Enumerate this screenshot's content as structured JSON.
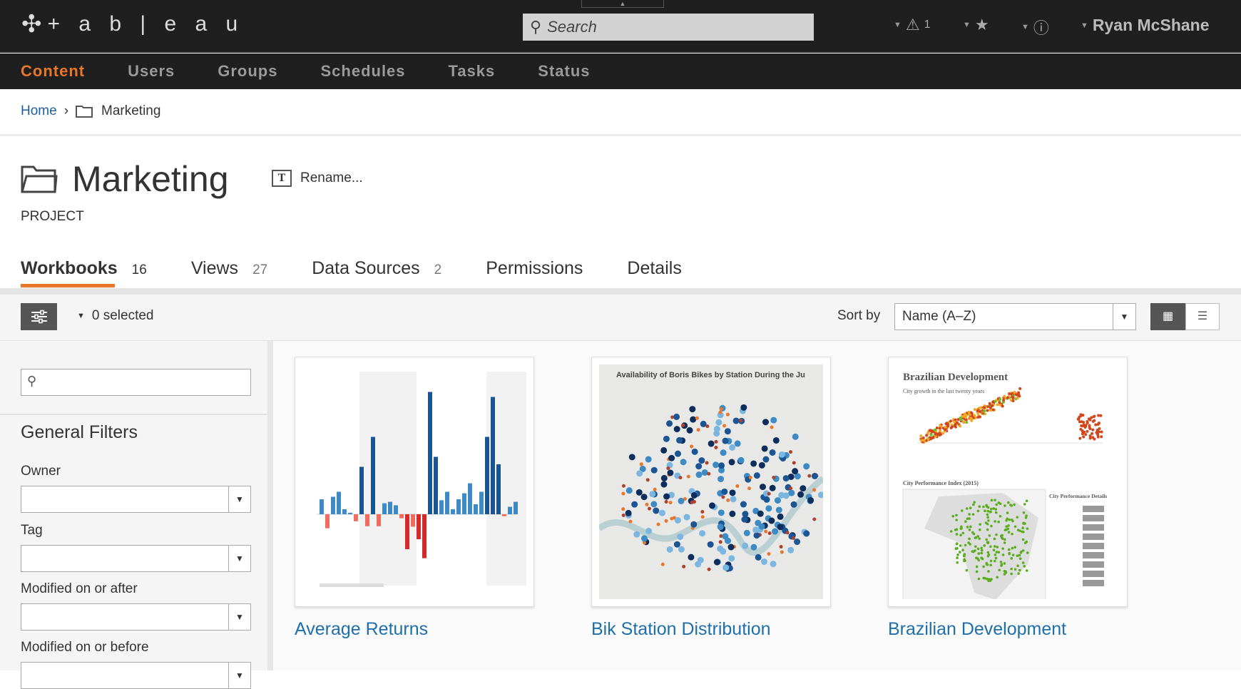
{
  "header": {
    "logo": "+ a b | e a u",
    "search_placeholder": "Search",
    "alerts_count": "1",
    "user": "Ryan McShane",
    "icons": [
      "tableau-logo-icon",
      "search-icon",
      "alert-icon",
      "star-icon",
      "info-icon"
    ]
  },
  "nav": {
    "items": [
      "Content",
      "Users",
      "Groups",
      "Schedules",
      "Tasks",
      "Status"
    ],
    "active": "Content"
  },
  "breadcrumb": {
    "home": "Home",
    "separator": "›",
    "current": "Marketing"
  },
  "page": {
    "title": "Marketing",
    "type": "PROJECT",
    "rename": "Rename...",
    "rename_icon": "T"
  },
  "tabs": [
    {
      "label": "Workbooks",
      "count": "16"
    },
    {
      "label": "Views",
      "count": "27"
    },
    {
      "label": "Data Sources",
      "count": "2"
    },
    {
      "label": "Permissions",
      "count": ""
    },
    {
      "label": "Details",
      "count": ""
    }
  ],
  "toolbar": {
    "selected": "0 selected",
    "sort_label": "Sort by",
    "sort_value": "Name (A–Z)"
  },
  "sidebar": {
    "search_value": "",
    "heading": "General Filters",
    "filters": [
      {
        "label": "Owner",
        "value": ""
      },
      {
        "label": "Tag",
        "value": ""
      },
      {
        "label": "Modified on or after",
        "value": ""
      },
      {
        "label": "Modified on or before",
        "value": ""
      }
    ]
  },
  "workbooks": [
    {
      "title": "Average Returns"
    },
    {
      "title": "Bik Station Distribution",
      "thumb_heading": "Availability of Boris Bikes by Station During the Ju"
    },
    {
      "title": "Brazilian Development",
      "thumb_heading": "Brazilian Development",
      "thumb_subheading": "City growth in the last twenty years",
      "thumb_section": "City Performance Index (2015)",
      "thumb_details": "City Performance Details"
    }
  ],
  "colors": {
    "accent": "#e8762b",
    "link": "#1f6faa",
    "topbar": "#1f1f1f"
  }
}
